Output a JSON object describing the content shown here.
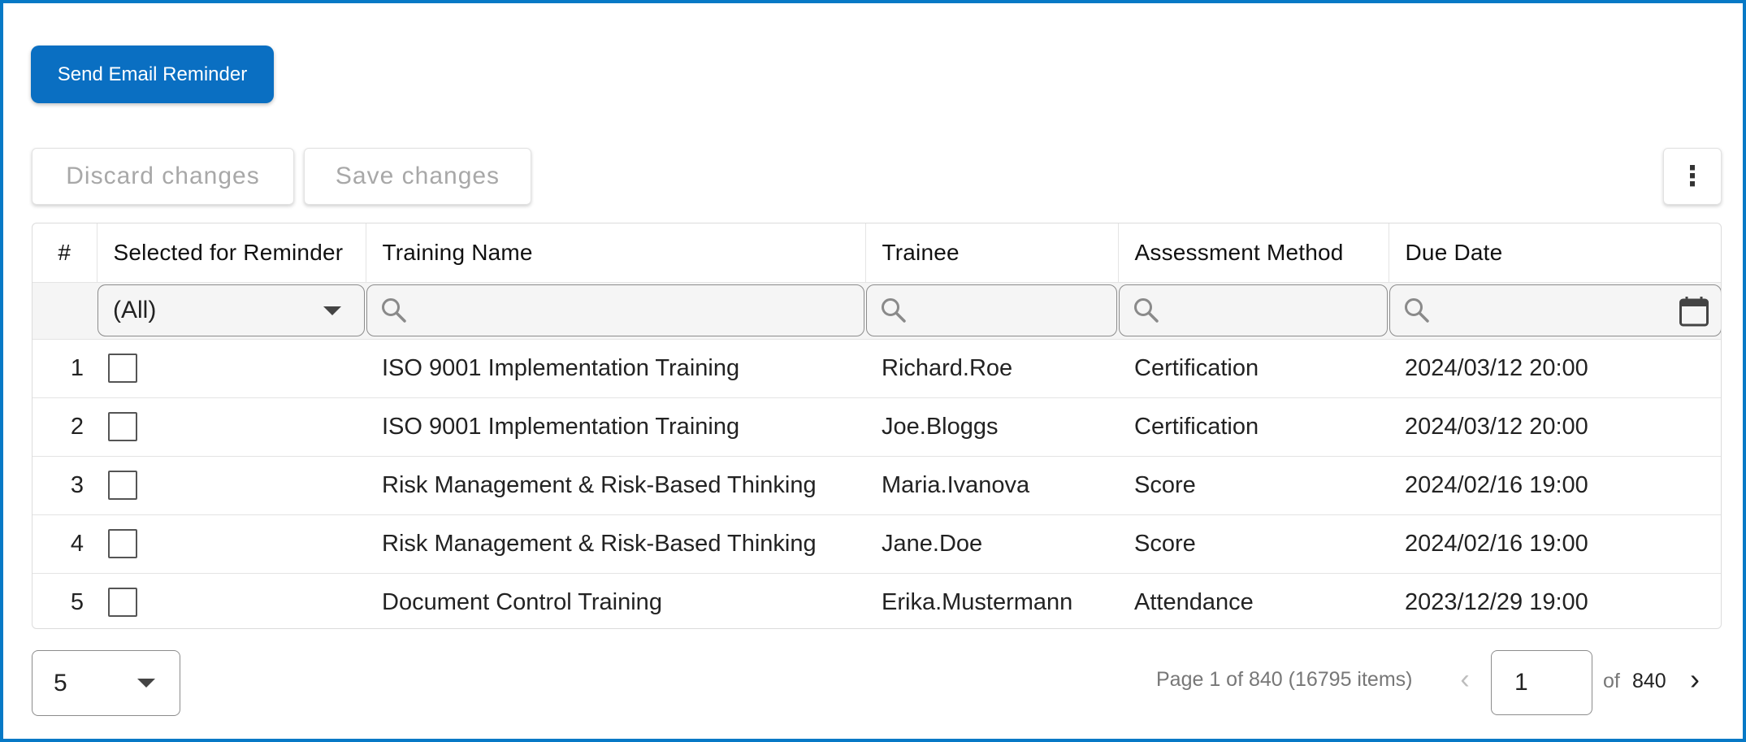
{
  "toolbar": {
    "send_email_label": "Send Email Reminder",
    "discard_label": "Discard changes",
    "save_label": "Save changes",
    "more_icon": "⋮"
  },
  "grid": {
    "columns": {
      "num": "#",
      "selected": "Selected for Reminder",
      "training": "Training Name",
      "trainee": "Trainee",
      "method": "Assessment Method",
      "due": "Due Date"
    },
    "filters": {
      "selected_value": "(All)",
      "training_value": "",
      "trainee_value": "",
      "method_value": "",
      "due_value": ""
    },
    "rows": [
      {
        "num": "1",
        "selected": false,
        "training": "ISO 9001 Implementation Training",
        "trainee": "Richard.Roe",
        "method": "Certification",
        "due": "2024/03/12 20:00"
      },
      {
        "num": "2",
        "selected": false,
        "training": "ISO 9001 Implementation Training",
        "trainee": "Joe.Bloggs",
        "method": "Certification",
        "due": "2024/03/12 20:00"
      },
      {
        "num": "3",
        "selected": false,
        "training": "Risk Management & Risk-Based Thinking",
        "trainee": "Maria.Ivanova",
        "method": "Score",
        "due": "2024/02/16 19:00"
      },
      {
        "num": "4",
        "selected": false,
        "training": "Risk Management & Risk-Based Thinking",
        "trainee": "Jane.Doe",
        "method": "Score",
        "due": "2024/02/16 19:00"
      },
      {
        "num": "5",
        "selected": false,
        "training": "Document Control Training",
        "trainee": "Erika.Mustermann",
        "method": "Attendance",
        "due": "2023/12/29 19:00"
      }
    ]
  },
  "pager": {
    "page_size": "5",
    "info": "Page 1 of 840 (16795 items)",
    "prev_icon": "‹",
    "current_page": "1",
    "of_label": "of",
    "total_pages": "840",
    "next_icon": "›"
  },
  "colors": {
    "accent": "#0a6fc2",
    "frame": "#0779c6",
    "filter_bg": "#f5f5f5"
  }
}
